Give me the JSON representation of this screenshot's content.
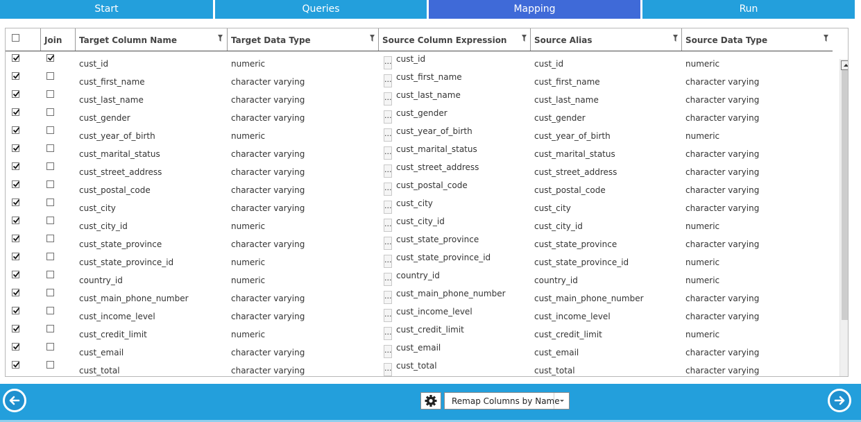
{
  "tabs": [
    {
      "label": "Start",
      "active": false
    },
    {
      "label": "Queries",
      "active": false
    },
    {
      "label": "Mapping",
      "active": true
    },
    {
      "label": "Run",
      "active": false
    }
  ],
  "grid": {
    "columns": {
      "join": "Join",
      "target_column": "Target Column Name",
      "target_type": "Target Data Type",
      "source_expr": "Source Column Expression",
      "source_alias": "Source Alias",
      "source_type": "Source Data Type"
    },
    "expr_button_label": "...",
    "rows": [
      {
        "selected": true,
        "join": true,
        "target": "cust_id",
        "target_type": "numeric",
        "expr": "cust_id",
        "alias": "cust_id",
        "source_type": "numeric"
      },
      {
        "selected": true,
        "join": false,
        "target": "cust_first_name",
        "target_type": "character varying",
        "expr": "cust_first_name",
        "alias": "cust_first_name",
        "source_type": "character varying"
      },
      {
        "selected": true,
        "join": false,
        "target": "cust_last_name",
        "target_type": "character varying",
        "expr": "cust_last_name",
        "alias": "cust_last_name",
        "source_type": "character varying"
      },
      {
        "selected": true,
        "join": false,
        "target": "cust_gender",
        "target_type": "character varying",
        "expr": "cust_gender",
        "alias": "cust_gender",
        "source_type": "character varying"
      },
      {
        "selected": true,
        "join": false,
        "target": "cust_year_of_birth",
        "target_type": "numeric",
        "expr": "cust_year_of_birth",
        "alias": "cust_year_of_birth",
        "source_type": "numeric"
      },
      {
        "selected": true,
        "join": false,
        "target": "cust_marital_status",
        "target_type": "character varying",
        "expr": "cust_marital_status",
        "alias": "cust_marital_status",
        "source_type": "character varying"
      },
      {
        "selected": true,
        "join": false,
        "target": "cust_street_address",
        "target_type": "character varying",
        "expr": "cust_street_address",
        "alias": "cust_street_address",
        "source_type": "character varying"
      },
      {
        "selected": true,
        "join": false,
        "target": "cust_postal_code",
        "target_type": "character varying",
        "expr": "cust_postal_code",
        "alias": "cust_postal_code",
        "source_type": "character varying"
      },
      {
        "selected": true,
        "join": false,
        "target": "cust_city",
        "target_type": "character varying",
        "expr": "cust_city",
        "alias": "cust_city",
        "source_type": "character varying"
      },
      {
        "selected": true,
        "join": false,
        "target": "cust_city_id",
        "target_type": "numeric",
        "expr": "cust_city_id",
        "alias": "cust_city_id",
        "source_type": "numeric"
      },
      {
        "selected": true,
        "join": false,
        "target": "cust_state_province",
        "target_type": "character varying",
        "expr": "cust_state_province",
        "alias": "cust_state_province",
        "source_type": "character varying"
      },
      {
        "selected": true,
        "join": false,
        "target": "cust_state_province_id",
        "target_type": "numeric",
        "expr": "cust_state_province_id",
        "alias": "cust_state_province_id",
        "source_type": "numeric"
      },
      {
        "selected": true,
        "join": false,
        "target": "country_id",
        "target_type": "numeric",
        "expr": "country_id",
        "alias": "country_id",
        "source_type": "numeric"
      },
      {
        "selected": true,
        "join": false,
        "target": "cust_main_phone_number",
        "target_type": "character varying",
        "expr": "cust_main_phone_number",
        "alias": "cust_main_phone_number",
        "source_type": "character varying"
      },
      {
        "selected": true,
        "join": false,
        "target": "cust_income_level",
        "target_type": "character varying",
        "expr": "cust_income_level",
        "alias": "cust_income_level",
        "source_type": "character varying"
      },
      {
        "selected": true,
        "join": false,
        "target": "cust_credit_limit",
        "target_type": "numeric",
        "expr": "cust_credit_limit",
        "alias": "cust_credit_limit",
        "source_type": "numeric"
      },
      {
        "selected": true,
        "join": false,
        "target": "cust_email",
        "target_type": "character varying",
        "expr": "cust_email",
        "alias": "cust_email",
        "source_type": "character varying"
      },
      {
        "selected": true,
        "join": false,
        "target": "cust_total",
        "target_type": "character varying",
        "expr": "cust_total",
        "alias": "cust_total",
        "source_type": "character varying"
      }
    ]
  },
  "footer": {
    "remap_label": "Remap Columns by Name"
  },
  "colors": {
    "tab": "#239fdc",
    "tab_active": "#3f6ad8",
    "footer": "#239fdc"
  },
  "icons": {
    "back": "arrow-left-icon",
    "next": "arrow-right-icon",
    "settings": "gear-icon"
  }
}
